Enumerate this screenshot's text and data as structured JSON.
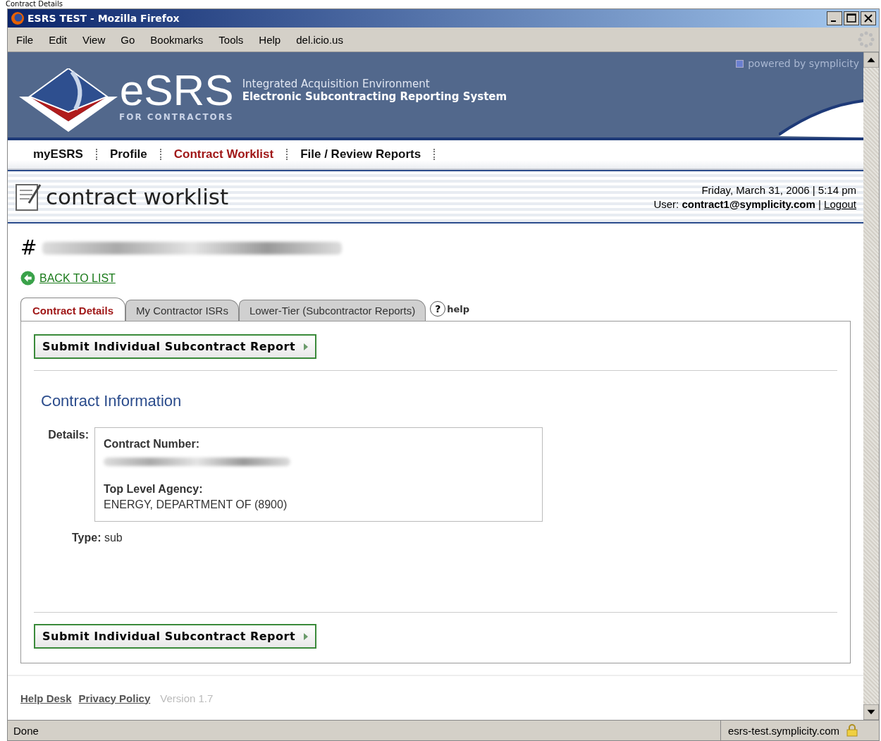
{
  "page_caption": "Contract Details",
  "window": {
    "title": "ESRS TEST - Mozilla Firefox"
  },
  "menu": [
    "File",
    "Edit",
    "View",
    "Go",
    "Bookmarks",
    "Tools",
    "Help",
    "del.icio.us"
  ],
  "banner": {
    "logo": "eSRS",
    "logo_sub": "FOR CONTRACTORS",
    "line1": "Integrated Acquisition Environment",
    "line2": "Electronic Subcontracting Reporting System",
    "powered": "powered by symplicity"
  },
  "nav": [
    {
      "label": "myESRS",
      "selected": false
    },
    {
      "label": "Profile",
      "selected": false
    },
    {
      "label": "Contract Worklist",
      "selected": true
    },
    {
      "label": "File / Review Reports",
      "selected": false
    }
  ],
  "header": {
    "title": "contract worklist",
    "date": "Friday, March 31, 2006 | 5:14 pm",
    "user_label": "User:",
    "user": "contract1@symplicity.com",
    "sep": "|",
    "logout": "Logout"
  },
  "record": {
    "hash": "#"
  },
  "back": "BACK TO LIST",
  "tabs": [
    {
      "label": "Contract Details",
      "selected": true
    },
    {
      "label": "My Contractor ISRs",
      "selected": false
    },
    {
      "label": "Lower-Tier (Subcontractor Reports)",
      "selected": false
    }
  ],
  "help": {
    "icon": "?",
    "label": "help"
  },
  "submit_buttons": [
    "Submit Individual Subcontract Report",
    "Submit Individual Subcontract Report"
  ],
  "section_title": "Contract Information",
  "details": {
    "label": "Details:",
    "fields": [
      {
        "label": "Contract Number:",
        "redacted": true
      },
      {
        "label": "Top Level Agency:",
        "value": "ENERGY, DEPARTMENT OF (8900)"
      }
    ]
  },
  "type": {
    "label": "Type:",
    "value": "sub"
  },
  "footer": {
    "links": [
      "Help Desk",
      "Privacy Policy"
    ],
    "version": "Version 1.7"
  },
  "status_bar": {
    "text": "Done",
    "host": "esrs-test.symplicity.com"
  }
}
